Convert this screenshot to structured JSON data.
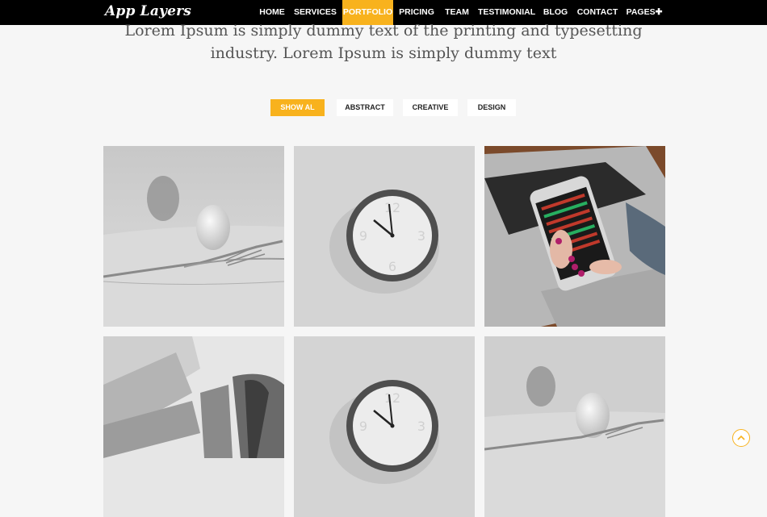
{
  "brand": {
    "logo_text": "App Layers"
  },
  "nav": {
    "items": [
      {
        "label": "HOME"
      },
      {
        "label": "SERVICES"
      },
      {
        "label": "PORTFOLIO"
      },
      {
        "label": "PRICING"
      },
      {
        "label": "TEAM"
      },
      {
        "label": "TESTIMONIAL"
      },
      {
        "label": "BLOG"
      },
      {
        "label": "CONTACT"
      },
      {
        "label": "PAGES✚"
      }
    ],
    "active": "PORTFOLIO"
  },
  "hero": {
    "line1": "Lorem Ipsum is simply dummy text of the printing and typesetting",
    "line2": "industry. Lorem Ipsum is simply dummy text"
  },
  "filters": {
    "items": [
      {
        "label": "SHOW AL"
      },
      {
        "label": "ABSTRACT"
      },
      {
        "label": "CREATIVE"
      },
      {
        "label": "DESIGN"
      }
    ],
    "active": "SHOW AL"
  },
  "portfolio": {
    "tiles": [
      {
        "subject": "egg-on-fork"
      },
      {
        "subject": "wall-clock"
      },
      {
        "subject": "phone-on-laptop"
      },
      {
        "subject": "architecture"
      },
      {
        "subject": "wall-clock"
      },
      {
        "subject": "egg-on-fork"
      }
    ]
  },
  "colors": {
    "accent": "#f8b21d",
    "topbar": "#000000",
    "background": "#f6f6f6"
  },
  "icons": {
    "scroll_top": "chevron-up-icon"
  }
}
